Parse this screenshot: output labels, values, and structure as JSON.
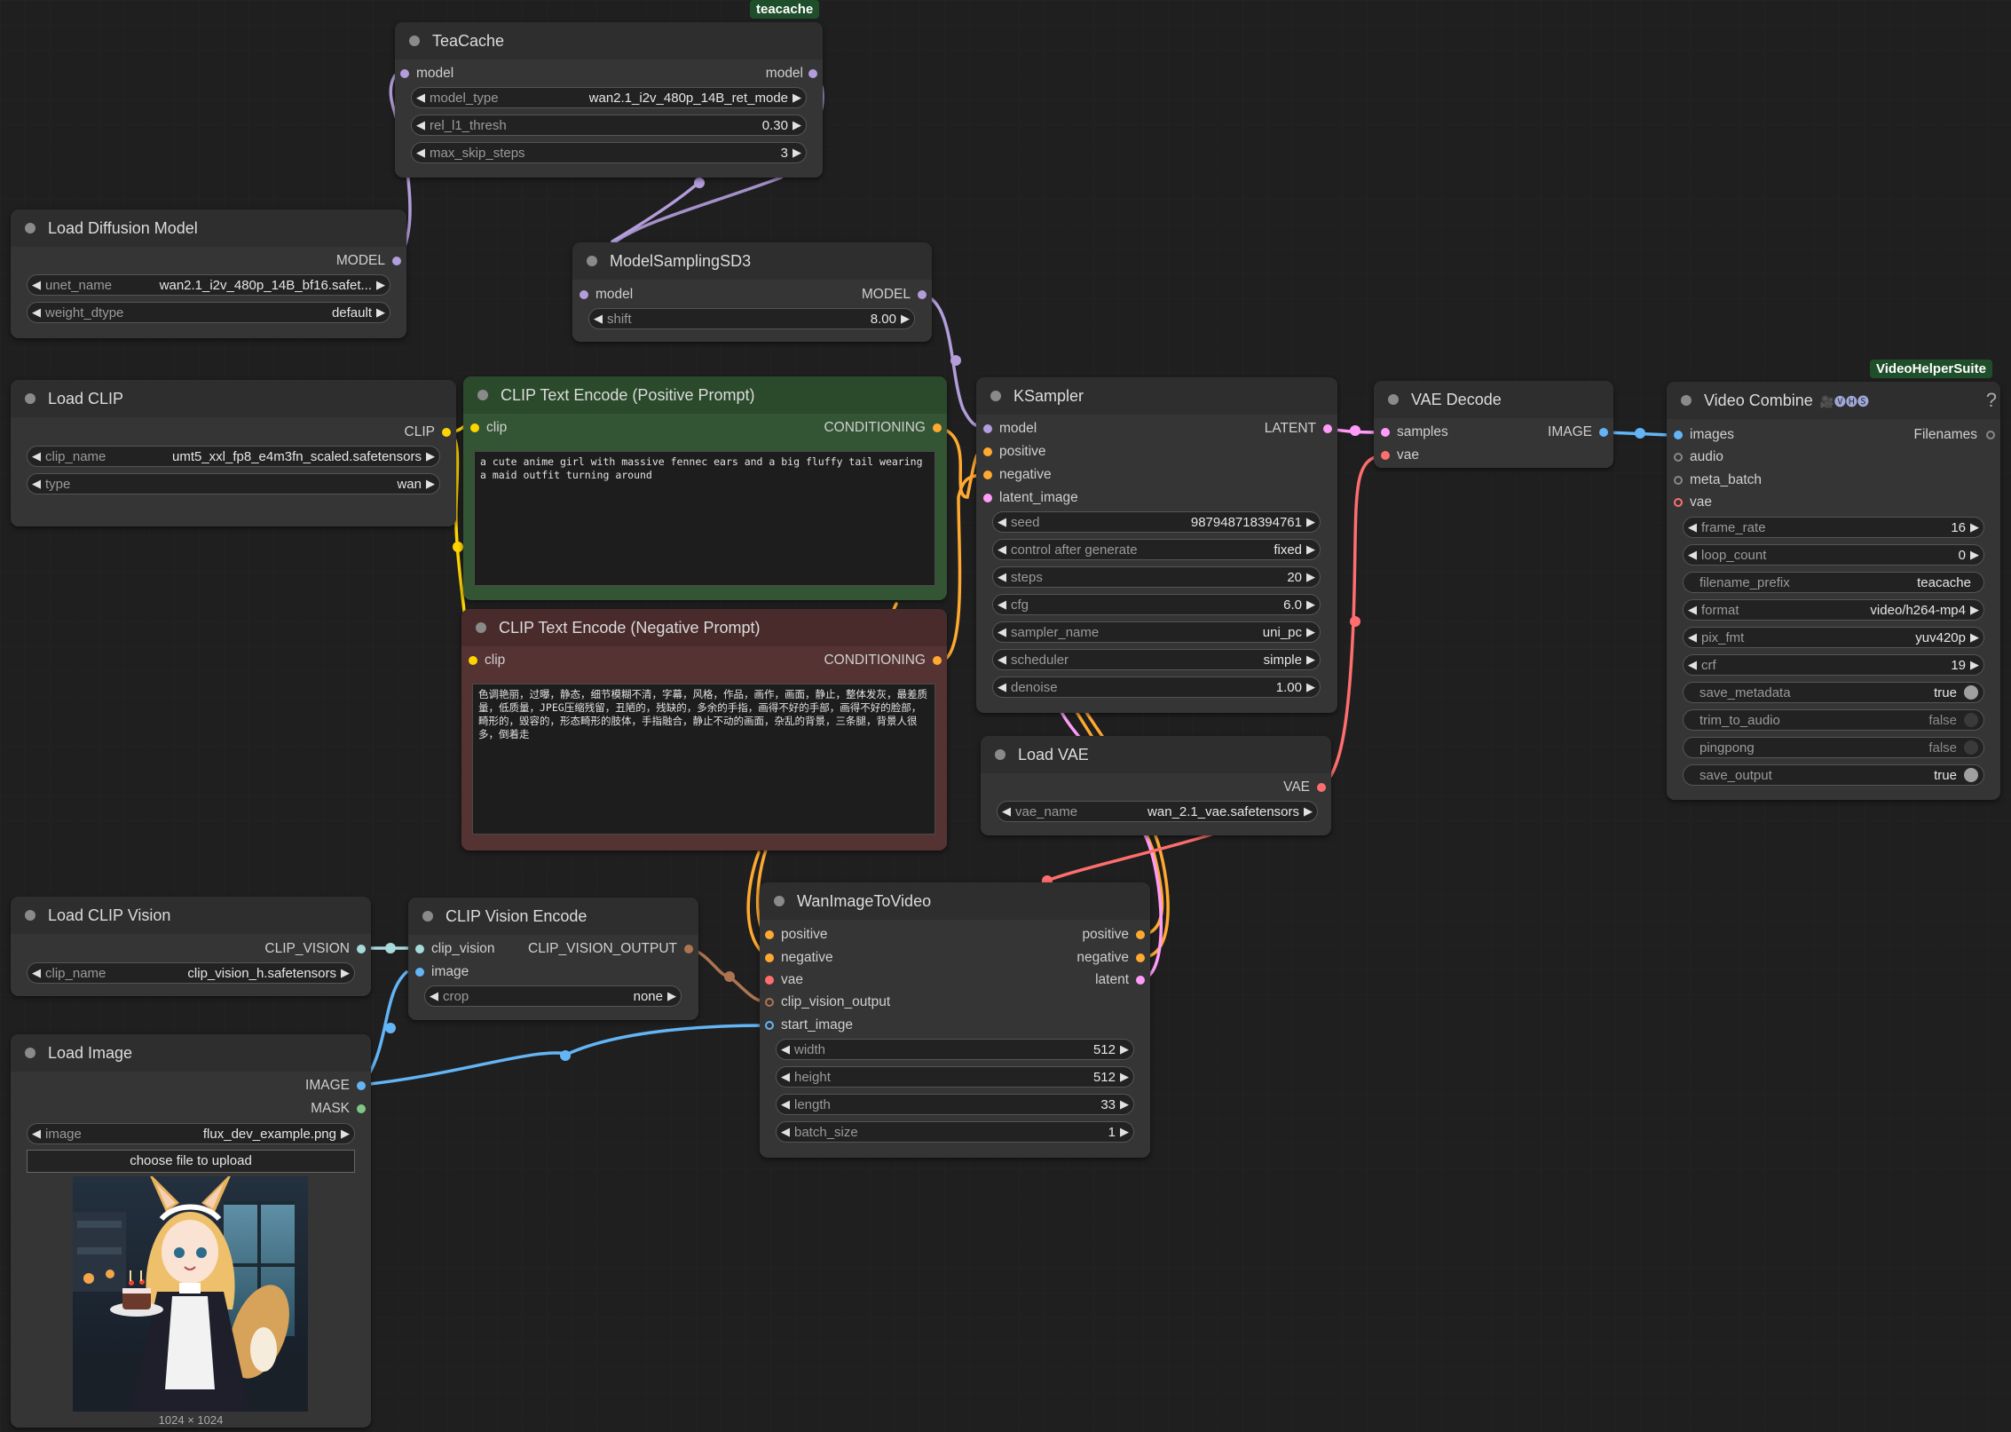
{
  "badges": {
    "teacache": "teacache",
    "vhs": "VideoHelperSuite"
  },
  "teacache": {
    "title": "TeaCache",
    "in_model": "model",
    "out_model": "model",
    "w": [
      {
        "label": "model_type",
        "value": "wan2.1_i2v_480p_14B_ret_mode"
      },
      {
        "label": "rel_l1_thresh",
        "value": "0.30"
      },
      {
        "label": "max_skip_steps",
        "value": "3"
      }
    ]
  },
  "load_diffusion": {
    "title": "Load Diffusion Model",
    "out": "MODEL",
    "w": [
      {
        "label": "unet_name",
        "value": "wan2.1_i2v_480p_14B_bf16.safet..."
      },
      {
        "label": "weight_dtype",
        "value": "default"
      }
    ]
  },
  "sd3": {
    "title": "ModelSamplingSD3",
    "in": "model",
    "out": "MODEL",
    "w": [
      {
        "label": "shift",
        "value": "8.00"
      }
    ]
  },
  "load_clip": {
    "title": "Load CLIP",
    "out": "CLIP",
    "w": [
      {
        "label": "clip_name",
        "value": "umt5_xxl_fp8_e4m3fn_scaled.safetensors"
      },
      {
        "label": "type",
        "value": "wan"
      }
    ]
  },
  "pos": {
    "title": "CLIP Text Encode (Positive Prompt)",
    "in": "clip",
    "out": "CONDITIONING",
    "text": "a cute anime girl with massive fennec ears and a big fluffy tail wearing a maid outfit turning around"
  },
  "neg": {
    "title": "CLIP Text Encode (Negative Prompt)",
    "in": "clip",
    "out": "CONDITIONING",
    "text": "色调艳丽，过曝，静态，细节模糊不清，字幕，风格，作品，画作，画面，静止，整体发灰，最差质量，低质量，JPEG压缩残留，丑陋的，残缺的，多余的手指，画得不好的手部，画得不好的脸部，畸形的，毁容的，形态畸形的肢体，手指融合，静止不动的画面，杂乱的背景，三条腿，背景人很多，倒着走"
  },
  "ksampler": {
    "title": "KSampler",
    "ins": [
      "model",
      "positive",
      "negative",
      "latent_image"
    ],
    "out": "LATENT",
    "w": [
      {
        "label": "seed",
        "value": "987948718394761"
      },
      {
        "label": "control after generate",
        "value": "fixed"
      },
      {
        "label": "steps",
        "value": "20"
      },
      {
        "label": "cfg",
        "value": "6.0"
      },
      {
        "label": "sampler_name",
        "value": "uni_pc"
      },
      {
        "label": "scheduler",
        "value": "simple"
      },
      {
        "label": "denoise",
        "value": "1.00"
      }
    ]
  },
  "vae_decode": {
    "title": "VAE Decode",
    "ins": [
      "samples",
      "vae"
    ],
    "out": "IMAGE"
  },
  "load_vae": {
    "title": "Load VAE",
    "out": "VAE",
    "w": [
      {
        "label": "vae_name",
        "value": "wan_2.1_vae.safetensors"
      }
    ]
  },
  "video_combine": {
    "title": "Video Combine",
    "emoji": "🎥🅥🅗🅢",
    "help": "?",
    "ins": [
      "images",
      "audio",
      "meta_batch",
      "vae"
    ],
    "out": "Filenames",
    "w": [
      {
        "label": "frame_rate",
        "value": "16"
      },
      {
        "label": "loop_count",
        "value": "0"
      },
      {
        "label": "filename_prefix",
        "value": "teacache"
      },
      {
        "label": "format",
        "value": "video/h264-mp4"
      },
      {
        "label": "pix_fmt",
        "value": "yuv420p"
      },
      {
        "label": "crf",
        "value": "19"
      }
    ],
    "toggles": [
      {
        "label": "save_metadata",
        "value": "true"
      },
      {
        "label": "trim_to_audio",
        "value": "false"
      },
      {
        "label": "pingpong",
        "value": "false"
      },
      {
        "label": "save_output",
        "value": "true"
      }
    ]
  },
  "clip_vision_load": {
    "title": "Load CLIP Vision",
    "out": "CLIP_VISION",
    "w": [
      {
        "label": "clip_name",
        "value": "clip_vision_h.safetensors"
      }
    ]
  },
  "clip_vision_encode": {
    "title": "CLIP Vision Encode",
    "ins": [
      "clip_vision",
      "image"
    ],
    "out": "CLIP_VISION_OUTPUT",
    "w": [
      {
        "label": "crop",
        "value": "none"
      }
    ]
  },
  "load_image": {
    "title": "Load Image",
    "outs": [
      "IMAGE",
      "MASK"
    ],
    "w": [
      {
        "label": "image",
        "value": "flux_dev_example.png"
      }
    ],
    "upload": "choose file to upload",
    "dims": "1024 × 1024"
  },
  "wan": {
    "title": "WanImageToVideo",
    "ins": [
      "positive",
      "negative",
      "vae",
      "clip_vision_output",
      "start_image"
    ],
    "outs": [
      "positive",
      "negative",
      "latent"
    ],
    "w": [
      {
        "label": "width",
        "value": "512"
      },
      {
        "label": "height",
        "value": "512"
      },
      {
        "label": "length",
        "value": "33"
      },
      {
        "label": "batch_size",
        "value": "1"
      }
    ]
  },
  "colors": {
    "model": "#b39ddb",
    "clip": "#ffd500",
    "conditioning": "#ffa931",
    "latent": "#ff9cf9",
    "image": "#64b5f6",
    "vae": "#ff6e6e",
    "clip_vision": "#a8dadc",
    "clip_vision_output": "#ad7452",
    "mask": "#81c784"
  }
}
